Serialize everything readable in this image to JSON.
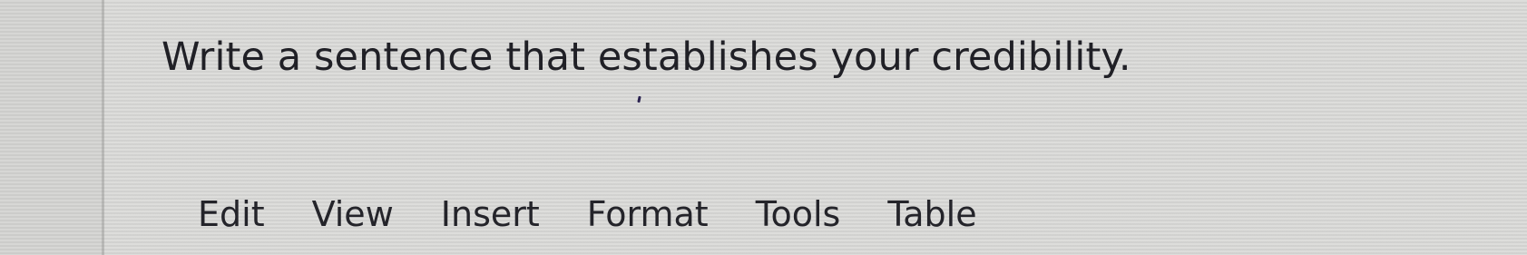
{
  "question": {
    "text": "Write a sentence that establishes your credibility."
  },
  "editor": {
    "menubar": {
      "items": [
        {
          "label": "Edit"
        },
        {
          "label": "View"
        },
        {
          "label": "Insert"
        },
        {
          "label": "Format"
        },
        {
          "label": "Tools"
        },
        {
          "label": "Table"
        }
      ]
    }
  }
}
